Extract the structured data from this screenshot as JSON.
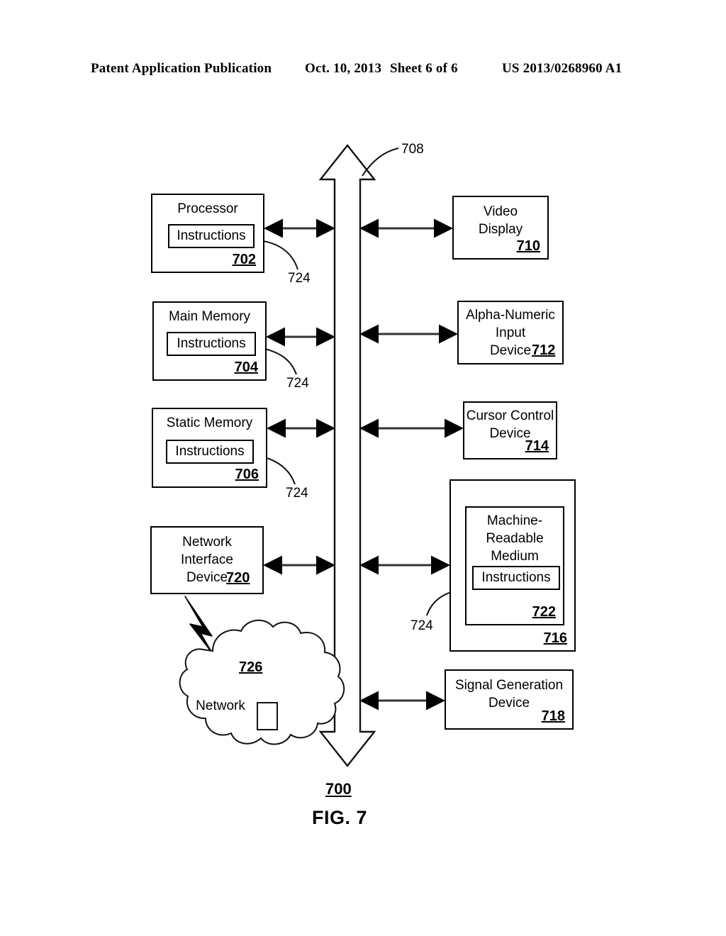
{
  "header": {
    "publication": "Patent Application Publication",
    "date": "Oct. 10, 2013",
    "sheet": "Sheet 6 of 6",
    "patent_number": "US 2013/0268960 A1"
  },
  "figure": {
    "caption": "FIG. 7",
    "system_ref": "700",
    "bus_ref": "708",
    "instructions_label": "Instructions",
    "left_blocks": [
      {
        "title": "Processor",
        "ref": "702",
        "has_instructions": true,
        "leader": "724"
      },
      {
        "title": "Main Memory",
        "ref": "704",
        "has_instructions": true,
        "leader": "724"
      },
      {
        "title": "Static Memory",
        "ref": "706",
        "has_instructions": true,
        "leader": "724"
      },
      {
        "title": "Network\nInterface\nDevice",
        "ref": "720",
        "has_instructions": false,
        "leader": ""
      }
    ],
    "right_blocks": [
      {
        "title": "Video\nDisplay",
        "ref": "710"
      },
      {
        "title": "Alpha-Numeric\nInput\nDevice",
        "ref": "712"
      },
      {
        "title": "Cursor Control\nDevice",
        "ref": "714"
      },
      {
        "title": "Machine-\nReadable\nMedium",
        "ref": "722",
        "outer_ref": "716",
        "has_instructions": true,
        "leader": "724"
      },
      {
        "title": "Signal Generation\nDevice",
        "ref": "718"
      }
    ],
    "network": {
      "label": "Network",
      "ref": "726"
    },
    "leader_labels": {
      "bus": "708",
      "processor_instructions": "724",
      "main_memory_instructions": "724",
      "static_memory_instructions": "724",
      "medium_instructions": "724"
    },
    "colors": {
      "ink": "#000000",
      "paper": "#ffffff"
    }
  }
}
